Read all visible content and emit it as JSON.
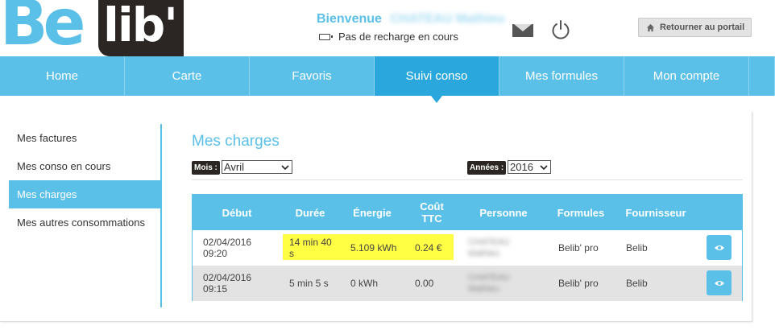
{
  "brand": {
    "part1": "Be",
    "part2": "lib'"
  },
  "header": {
    "welcome_label": "Bienvenue",
    "user_name": "CHATEAU Mathieu",
    "recharge_status": "Pas de recharge en cours",
    "portal_button": "Retourner au portail"
  },
  "nav": {
    "items": [
      {
        "label": "Home"
      },
      {
        "label": "Carte"
      },
      {
        "label": "Favoris"
      },
      {
        "label": "Suivi conso"
      },
      {
        "label": "Mes formules"
      },
      {
        "label": "Mon compte"
      }
    ],
    "active": "Suivi conso"
  },
  "sidebar": {
    "items": [
      {
        "label": "Mes factures"
      },
      {
        "label": "Mes conso en cours"
      },
      {
        "label": "Mes charges"
      },
      {
        "label": "Mes autres consommations"
      }
    ],
    "active": "Mes charges"
  },
  "main": {
    "title": "Mes charges",
    "month_label": "Mois :",
    "month_value": "Avril",
    "year_label": "Années :",
    "year_value": "2016"
  },
  "table": {
    "headers": [
      "Début",
      "Durée",
      "Énergie",
      "Coût TTC",
      "Personne",
      "Formules",
      "Fournisseur"
    ],
    "rows": [
      {
        "debut": "02/04/2016 09:20",
        "duree": "14 min 40 s",
        "energie": "5.109 kWh",
        "cout": "0.24 €",
        "personne": "CHATEAU Mathieu",
        "formule": "Belib' pro",
        "fournisseur": "Belib"
      },
      {
        "debut": "02/04/2016 09:15",
        "duree": "5 min 5 s",
        "energie": "0 kWh",
        "cout": "0.00",
        "personne": "CHATEAU Mathieu",
        "formule": "Belib' pro",
        "fournisseur": "Belib"
      }
    ]
  },
  "colors": {
    "accent": "#5bc0e8",
    "accent_dark": "#2aa8de",
    "highlight": "#ffff44",
    "dark": "#2b2523"
  },
  "icons": [
    "envelope-icon",
    "power-icon",
    "home-icon",
    "battery-icon",
    "eye-icon",
    "chevron-down-icon"
  ]
}
